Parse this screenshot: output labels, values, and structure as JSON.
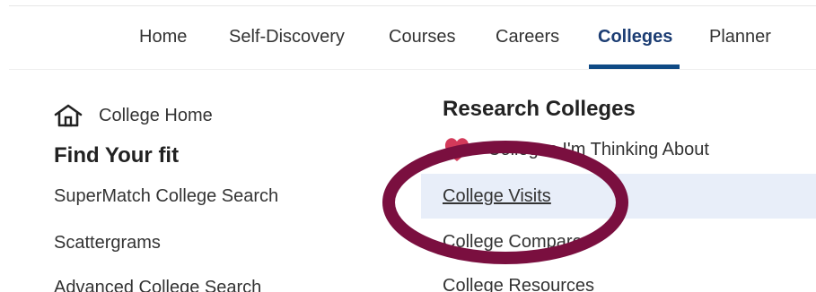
{
  "nav": {
    "items": [
      {
        "label": "Home"
      },
      {
        "label": "Self-Discovery"
      },
      {
        "label": "Courses"
      },
      {
        "label": "Careers"
      },
      {
        "label": "Colleges",
        "active": true
      },
      {
        "label": "Planner"
      }
    ]
  },
  "left": {
    "home_link": "College Home",
    "find_fit_title": "Find Your fit",
    "links": [
      "SuperMatch College Search",
      "Scattergrams",
      "Advanced College Search"
    ]
  },
  "right": {
    "title": "Research Colleges",
    "links": [
      "Colleges I'm Thinking About",
      "College Visits",
      "College Compare",
      "College Resources"
    ]
  },
  "colors": {
    "accent": "#0f4a85",
    "highlight_row": "#e8eef9",
    "annotation": "#7a0f3f",
    "heart": "#d33a5a"
  },
  "icons": {
    "home": "house-icon",
    "favorite": "heart-icon"
  }
}
